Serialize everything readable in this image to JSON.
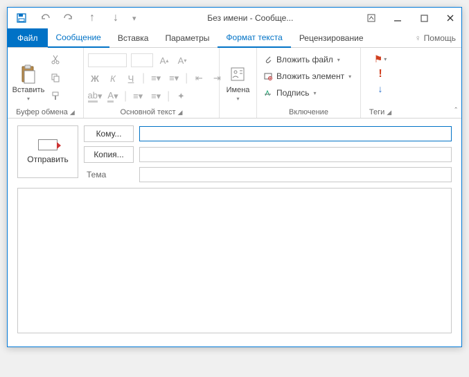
{
  "window": {
    "title": "Без имени - Сообще..."
  },
  "tabs": {
    "file": "Файл",
    "message": "Сообщение",
    "insert": "Вставка",
    "options": "Параметры",
    "format": "Формат текста",
    "review": "Рецензирование",
    "help": "Помощь"
  },
  "ribbon": {
    "clipboard": {
      "paste": "Вставить",
      "label": "Буфер обмена"
    },
    "basictext": {
      "label": "Основной текст",
      "bold": "Ж",
      "italic": "К",
      "underline": "Ч"
    },
    "names": {
      "label": "Имена"
    },
    "include": {
      "label": "Включение",
      "attachFile": "Вложить файл",
      "attachItem": "Вложить элемент",
      "signature": "Подпись"
    },
    "tags": {
      "label": "Теги"
    }
  },
  "compose": {
    "send": "Отправить",
    "to": "Кому...",
    "cc": "Копия...",
    "subject": "Тема",
    "toValue": "",
    "ccValue": "",
    "subjectValue": "",
    "bodyValue": ""
  }
}
